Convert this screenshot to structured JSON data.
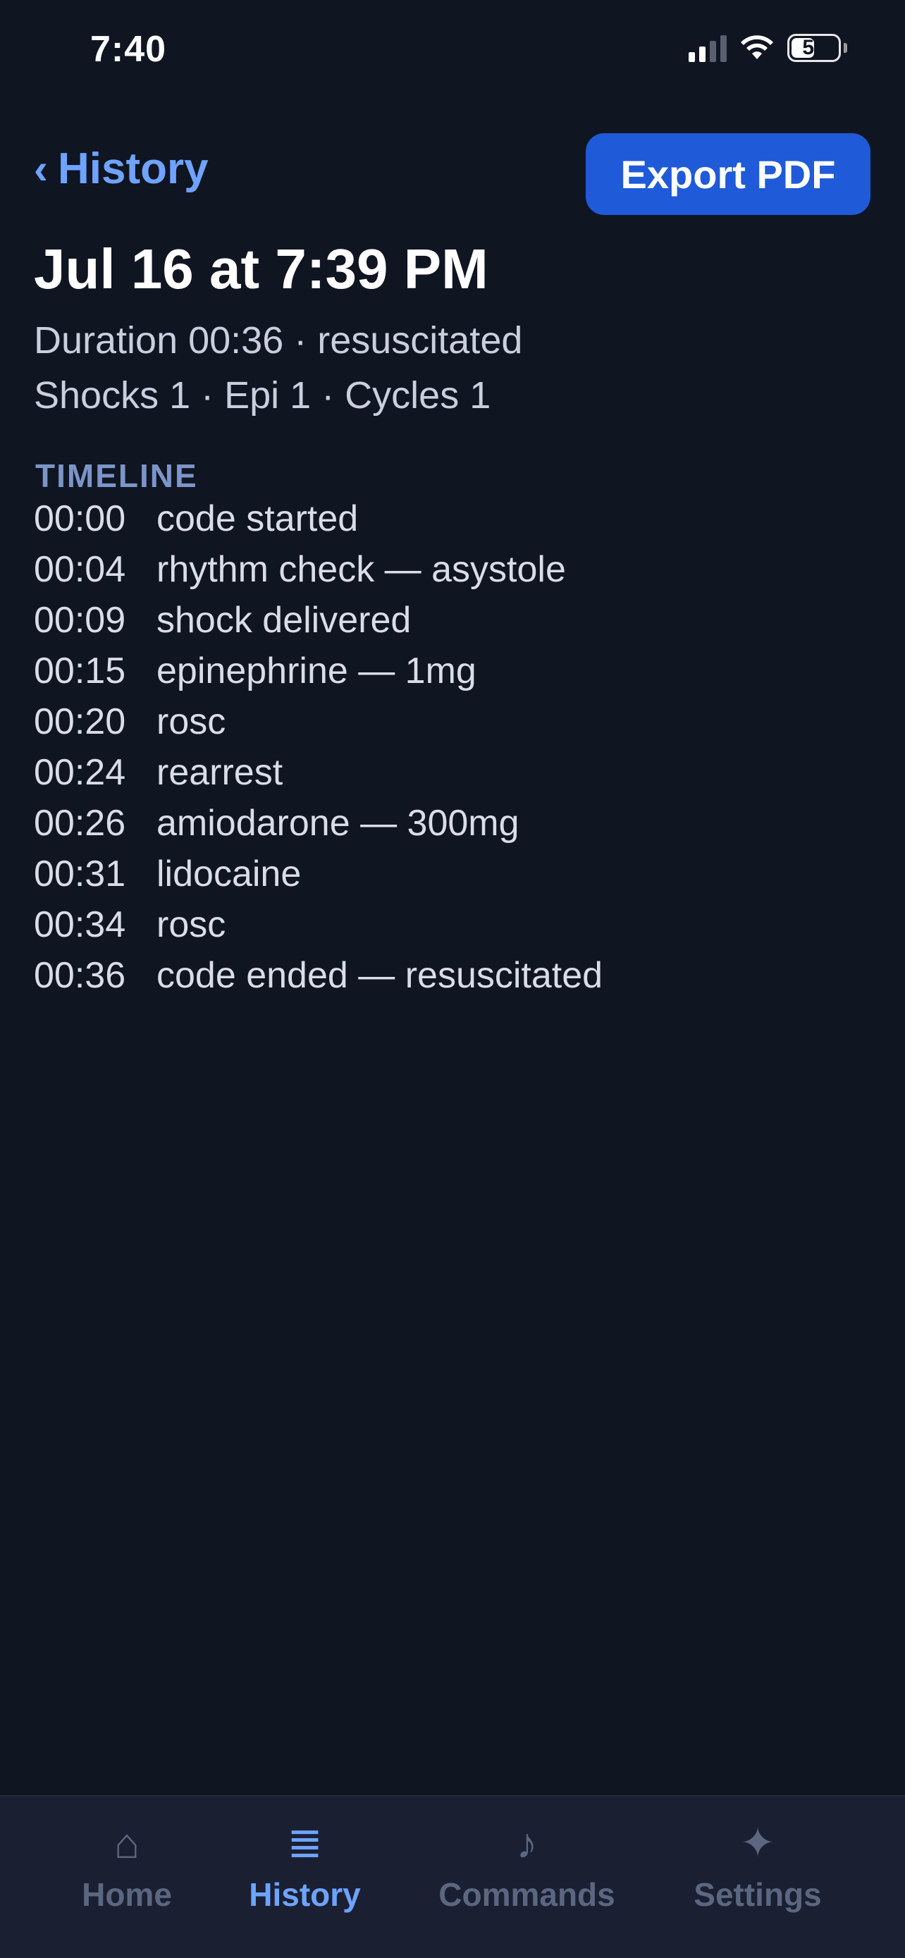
{
  "status_bar": {
    "time": "7:40",
    "battery": "50",
    "battery_level": 0.5,
    "icons": [
      "cellular-signal-icon",
      "wifi-icon",
      "battery-icon"
    ]
  },
  "nav": {
    "back_label": "History",
    "back_icon": "chevron-left-icon",
    "export_label": "Export PDF"
  },
  "record": {
    "title": "Jul 16 at 7:39 PM",
    "summary_line_1": "Duration 00:36 · resuscitated",
    "summary_line_2": "Shocks 1 · Epi 1 · Cycles 1"
  },
  "timeline": {
    "header": "TIMELINE",
    "events": [
      {
        "time": "00:00",
        "event": "code started"
      },
      {
        "time": "00:04",
        "event": "rhythm check — asystole"
      },
      {
        "time": "00:09",
        "event": "shock delivered"
      },
      {
        "time": "00:15",
        "event": "epinephrine — 1mg"
      },
      {
        "time": "00:20",
        "event": "rosc"
      },
      {
        "time": "00:24",
        "event": "rearrest"
      },
      {
        "time": "00:26",
        "event": "amiodarone — 300mg"
      },
      {
        "time": "00:31",
        "event": "lidocaine"
      },
      {
        "time": "00:34",
        "event": "rosc"
      },
      {
        "time": "00:36",
        "event": "code ended — resuscitated"
      }
    ]
  },
  "tab_bar": {
    "active": "History",
    "tabs": [
      {
        "label": "Home",
        "icon": "home-icon",
        "glyph": "⌂"
      },
      {
        "label": "History",
        "icon": "list-icon",
        "glyph": "≣"
      },
      {
        "label": "Commands",
        "icon": "music-note-icon",
        "glyph": "♪"
      },
      {
        "label": "Settings",
        "icon": "sparkle-icon",
        "glyph": "✦"
      }
    ]
  },
  "colors": {
    "background": "#101522",
    "accent": "#6ea3ff",
    "button": "#1f5ad8",
    "tab_inactive": "#5b6680",
    "section_header": "#7c95c8"
  }
}
